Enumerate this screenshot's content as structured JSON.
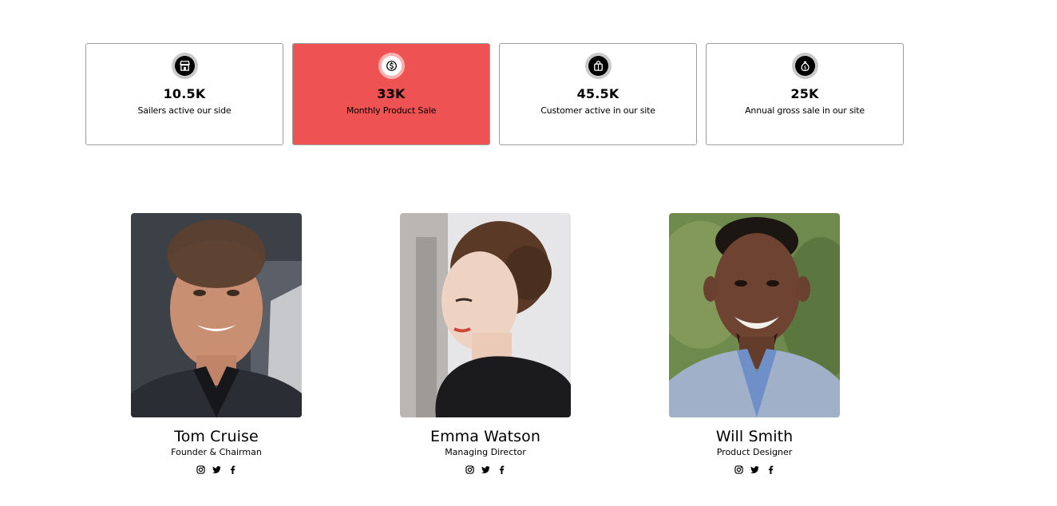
{
  "colors": {
    "accent": "#ef5253",
    "card_border": "#9e9e9e",
    "icon_ring": "#c9c9c9",
    "text": "#000000"
  },
  "stats": [
    {
      "icon": "store-icon",
      "value": "10.5K",
      "label": "Sailers active our side",
      "active": false
    },
    {
      "icon": "dollar-coin-icon",
      "value": "33K",
      "label": "Monthly Product Sale",
      "active": true
    },
    {
      "icon": "shopping-bag-icon",
      "value": "45.5K",
      "label": "Customer active in our site",
      "active": false
    },
    {
      "icon": "money-bag-icon",
      "value": "25K",
      "label": "Annual gross sale in our site",
      "active": false
    }
  ],
  "team": [
    {
      "name": "Tom Cruise",
      "role": "Founder & Chairman",
      "photo": "portrait-photo"
    },
    {
      "name": "Emma Watson",
      "role": "Managing Director",
      "photo": "portrait-photo"
    },
    {
      "name": "Will Smith",
      "role": "Product Designer",
      "photo": "portrait-photo"
    }
  ],
  "social_icons": [
    "instagram-icon",
    "twitter-icon",
    "facebook-icon"
  ]
}
